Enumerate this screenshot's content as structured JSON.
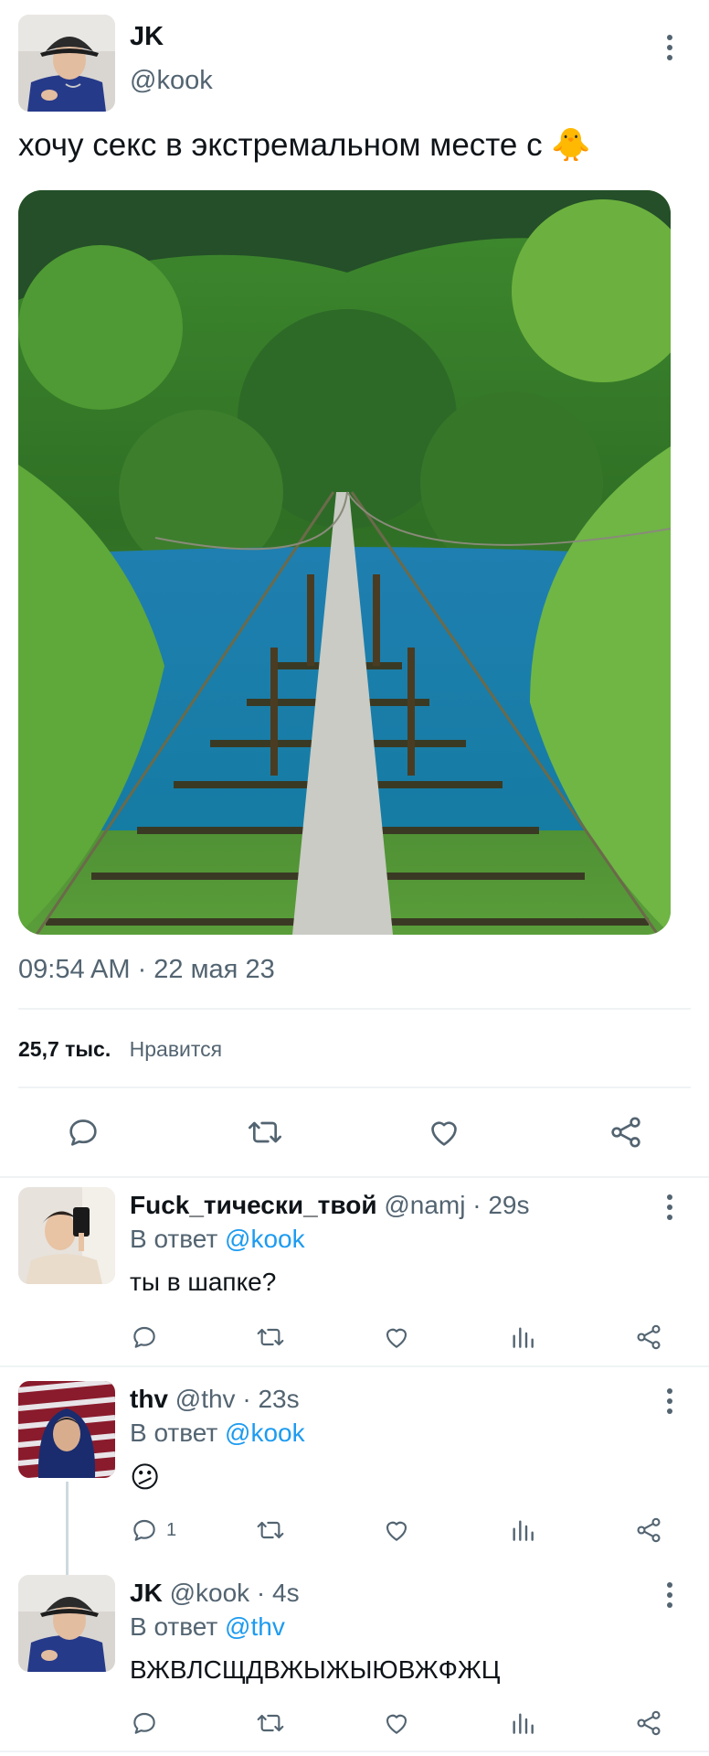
{
  "main_tweet": {
    "author_name": "JK",
    "author_handle": "@kook",
    "text": "хочу секс в экстремальном месте с 🐥",
    "timestamp": "09:54 AM · 22 мая 23",
    "likes_count": "25,7 тыс.",
    "likes_label": "Нравится"
  },
  "replies": [
    {
      "author_name": "Fuck_тически_твой",
      "meta": "@namj · 29s",
      "reply_prefix": "В ответ",
      "reply_to": "@kook",
      "text": "ты в шапке?",
      "reply_count": ""
    },
    {
      "author_name": "thv",
      "meta": "@thv · 23s",
      "reply_prefix": "В ответ",
      "reply_to": "@kook",
      "text": "😕",
      "reply_count": "1"
    },
    {
      "author_name": "JK",
      "meta": "@kook · 4s",
      "reply_prefix": "В ответ",
      "reply_to": "@thv",
      "text": "ВЖВЛСЩДВЖЫЖЫЮВЖФЖЦ",
      "reply_count": ""
    }
  ],
  "colors": {
    "accent": "#1d9bf0",
    "muted": "#536471",
    "divider": "#eff3f4"
  }
}
